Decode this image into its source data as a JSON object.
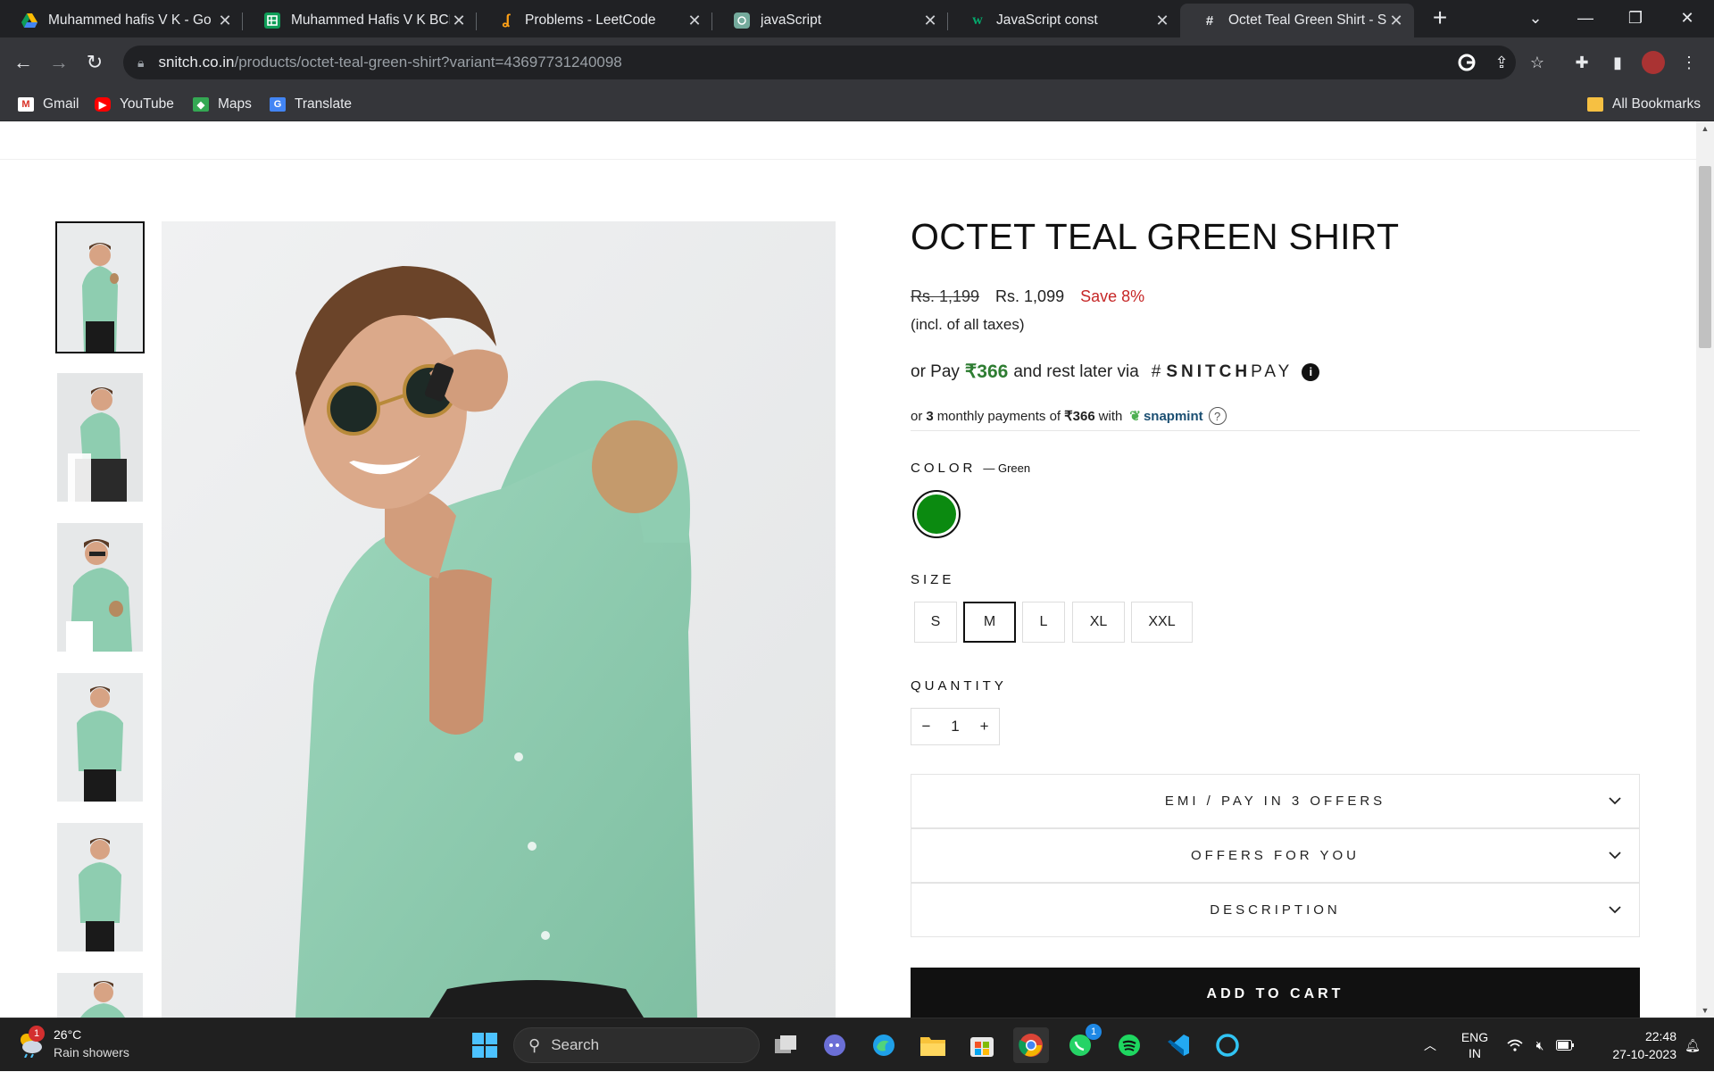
{
  "browser": {
    "tabs": [
      {
        "title": "Muhammed hafis V K - Go",
        "icon": "google-drive-icon",
        "active": false
      },
      {
        "title": "Muhammed Hafis V K BCE",
        "icon": "google-sheets-icon",
        "active": false
      },
      {
        "title": "Problems - LeetCode",
        "icon": "leetcode-icon",
        "active": false
      },
      {
        "title": "javaScript",
        "icon": "chatgpt-icon",
        "active": false
      },
      {
        "title": "JavaScript const",
        "icon": "w3schools-icon",
        "active": false
      },
      {
        "title": "Octet Teal Green Shirt - SN",
        "icon": "snitch-icon",
        "active": true
      }
    ],
    "url_host": "snitch.co.in",
    "url_path": "/products/octet-teal-green-shirt?variant=43697731240098",
    "bookmarks": [
      {
        "label": "Gmail",
        "icon": "gmail-icon"
      },
      {
        "label": "YouTube",
        "icon": "youtube-icon"
      },
      {
        "label": "Maps",
        "icon": "maps-icon"
      },
      {
        "label": "Translate",
        "icon": "translate-icon"
      }
    ],
    "all_bookmarks": "All Bookmarks"
  },
  "product": {
    "title": "OCTET TEAL GREEN SHIRT",
    "old_price": "Rs. 1,199",
    "price": "Rs. 1,099",
    "save": "Save 8%",
    "tax_note": "(incl. of all taxes)",
    "snitchpay": {
      "prefix": "or Pay",
      "amount": "₹366",
      "suffix": "and rest later via",
      "brand_bold": "SNITCH",
      "brand_light": "PAY"
    },
    "snapmint": {
      "p1": "or",
      "count": "3",
      "p2": "monthly payments of",
      "amount": "₹366",
      "p3": "with",
      "brand": "snapmint"
    },
    "color_label": "COLOR",
    "color_value": "— Green",
    "color_hex": "#0b8a10",
    "size_label": "SIZE",
    "sizes": [
      "S",
      "M",
      "L",
      "XL",
      "XXL"
    ],
    "selected_size": "M",
    "quantity_label": "QUANTITY",
    "quantity": "1",
    "qty_minus": "−",
    "qty_plus": "+",
    "accordions": [
      "EMI / PAY IN 3 OFFERS",
      "OFFERS FOR YOU",
      "DESCRIPTION"
    ],
    "add_to_cart": "ADD TO CART"
  },
  "taskbar": {
    "weather_temp": "26°C",
    "weather_desc": "Rain showers",
    "weather_badge": "1",
    "search": "Search",
    "lang1": "ENG",
    "lang2": "IN",
    "time": "22:48",
    "date": "27-10-2023",
    "whatsapp_badge": "1"
  }
}
